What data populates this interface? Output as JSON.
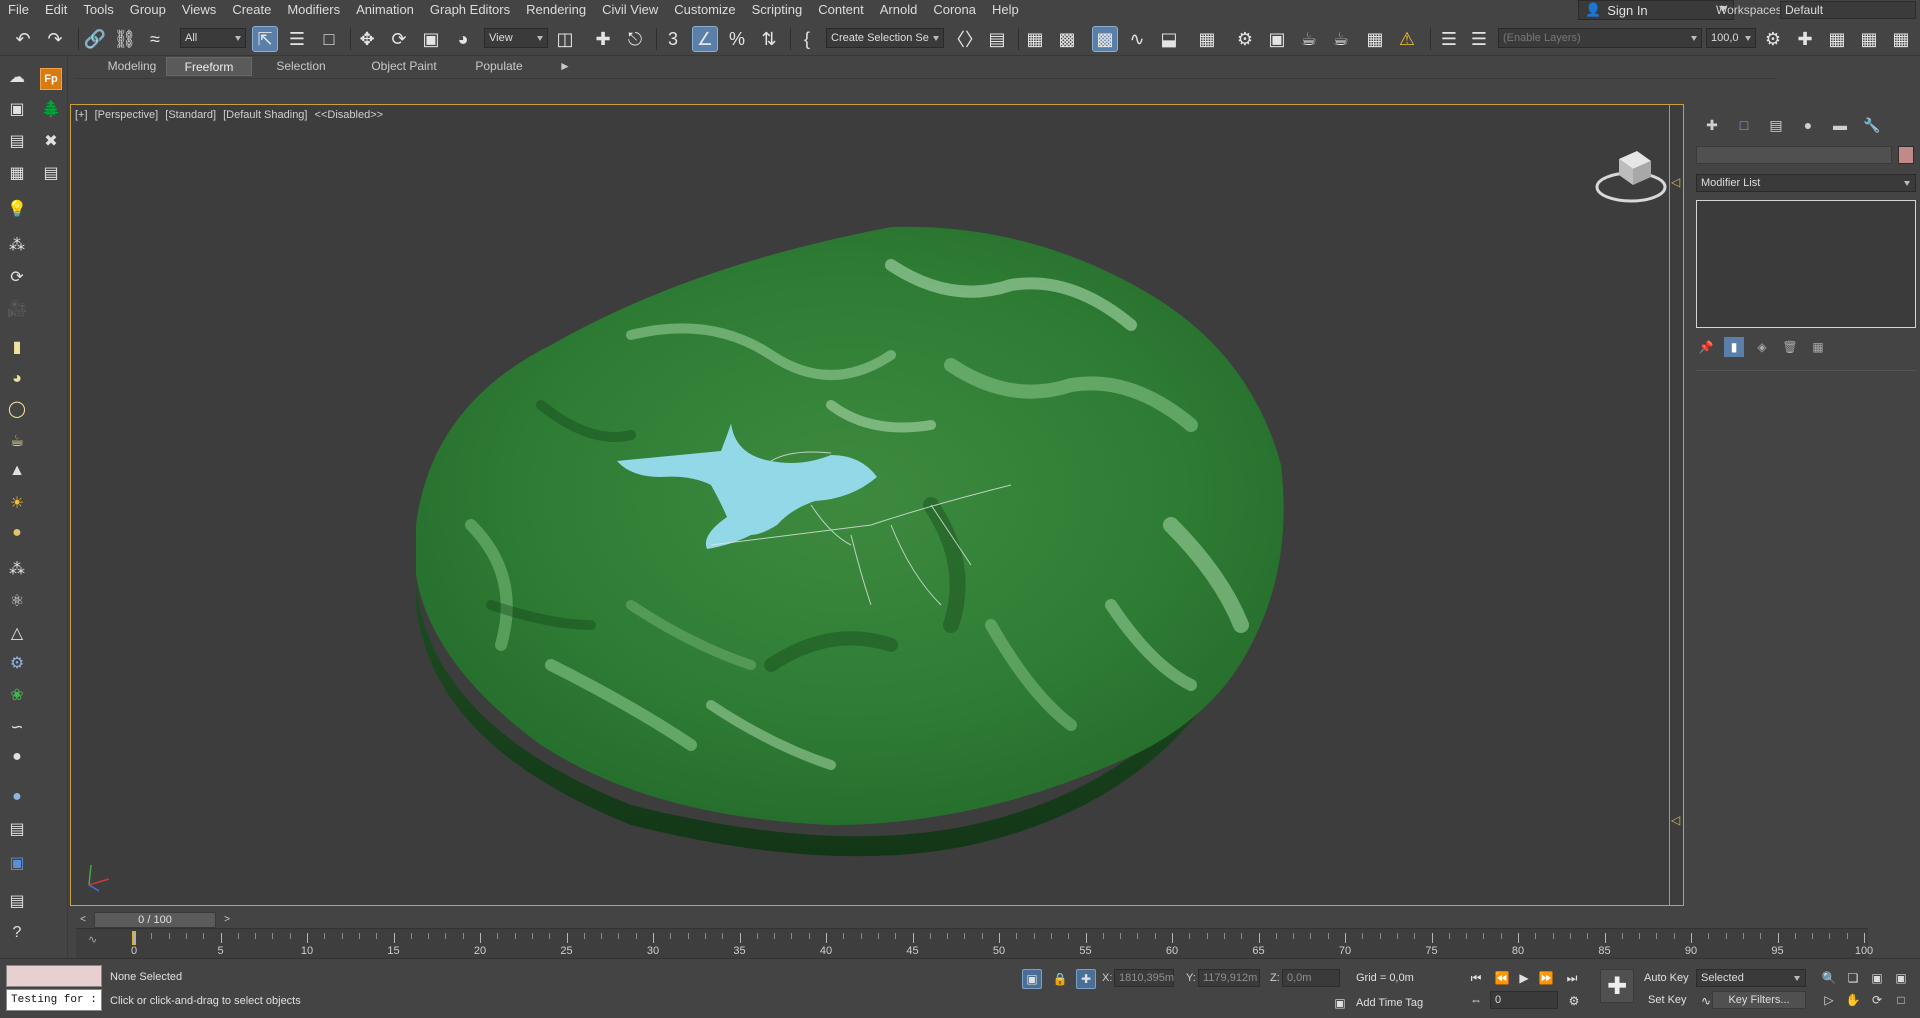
{
  "menu": {
    "items": [
      "File",
      "Edit",
      "Tools",
      "Group",
      "Views",
      "Create",
      "Modifiers",
      "Animation",
      "Graph Editors",
      "Rendering",
      "Civil View",
      "Customize",
      "Scripting",
      "Content",
      "Arnold",
      "Corona",
      "Help"
    ],
    "signin": "Sign In",
    "workspace_label": "Workspaces:",
    "workspace_value": "Default"
  },
  "toolbar": {
    "filter_select": "All",
    "coord_select": "View",
    "selection_set": "Create Selection Se",
    "layers_placeholder": "(Enable Layers)",
    "layers_value": "100,0"
  },
  "ribbon": {
    "tabs": [
      "Modeling",
      "Freeform",
      "Selection",
      "Object Paint",
      "Populate"
    ],
    "active": "Freeform"
  },
  "viewport": {
    "label_parts": [
      "[+]",
      "[Perspective]",
      "[Standard]",
      "[Default Shading]",
      "<<Disabled>>"
    ],
    "terrain_color": "#2f7d35",
    "water_color": "#93d8e6"
  },
  "command_panel": {
    "modifier_list": "Modifier List",
    "object_color": "#c08a8a"
  },
  "timeline": {
    "frame_display": "0 / 100",
    "ticks": [
      0,
      5,
      10,
      15,
      20,
      25,
      30,
      35,
      40,
      45,
      50,
      55,
      60,
      65,
      70,
      75,
      80,
      85,
      90,
      95,
      100
    ]
  },
  "status": {
    "maxscript_input": "Testing for :",
    "selection": "None Selected",
    "prompt": "Click or click-and-drag to select objects",
    "x_label": "X:",
    "x_value": "1810,395m",
    "y_label": "Y:",
    "y_value": "1179,912m",
    "z_label": "Z:",
    "z_value": "0,0m",
    "grid": "Grid = 0,0m",
    "time_tag": "Add Time Tag",
    "frame_value": "0",
    "auto_key": "Auto Key",
    "set_key": "Set Key",
    "key_mode": "Selected",
    "key_filters": "Key Filters..."
  }
}
